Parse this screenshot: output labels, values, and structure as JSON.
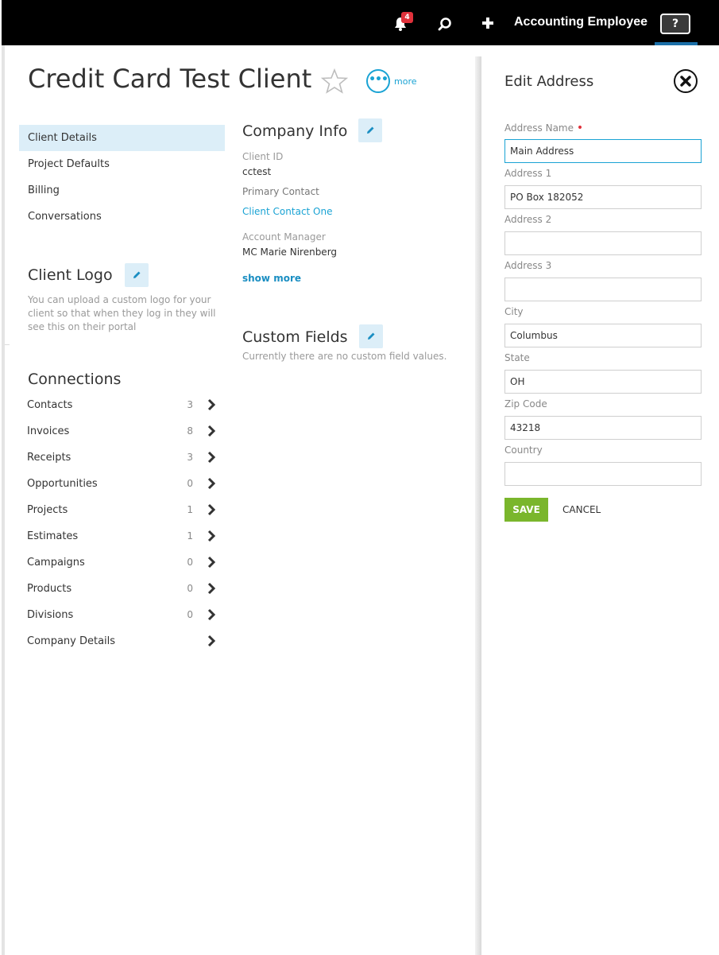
{
  "topbar": {
    "notification_count": "4",
    "user_name": "Accounting Employee",
    "help_label": "?",
    "icons": [
      "bell-icon",
      "search-icon",
      "plus-icon"
    ]
  },
  "header": {
    "title": "Credit Card Test Client",
    "more_label": "more"
  },
  "nav": {
    "items": [
      {
        "label": "Client Details",
        "active": true
      },
      {
        "label": "Project Defaults",
        "active": false
      },
      {
        "label": "Billing",
        "active": false
      },
      {
        "label": "Conversations",
        "active": false
      }
    ]
  },
  "client_logo": {
    "title": "Client Logo",
    "description": "You can upload a custom logo for your client so that when they log in they will see this on their portal"
  },
  "connections": {
    "title": "Connections",
    "rows": [
      {
        "label": "Contacts",
        "count": "3"
      },
      {
        "label": "Invoices",
        "count": "8"
      },
      {
        "label": "Receipts",
        "count": "3"
      },
      {
        "label": "Opportunities",
        "count": "0"
      },
      {
        "label": "Projects",
        "count": "1"
      },
      {
        "label": "Estimates",
        "count": "1"
      },
      {
        "label": "Campaigns",
        "count": "0"
      },
      {
        "label": "Products",
        "count": "0"
      },
      {
        "label": "Divisions",
        "count": "0"
      },
      {
        "label": "Company Details",
        "count": ""
      }
    ]
  },
  "company_info": {
    "title": "Company Info",
    "client_id_label": "Client ID",
    "client_id": "cctest",
    "primary_contact_label": "Primary Contact",
    "primary_contact": "Client Contact One",
    "account_manager_label": "Account Manager",
    "account_manager": "MC Marie Nirenberg",
    "show_more": "show more"
  },
  "custom_fields": {
    "title": "Custom Fields",
    "empty_text": "Currently there are no custom field values."
  },
  "edit_address": {
    "title": "Edit Address",
    "fields": [
      {
        "label": "Address Name",
        "value": "Main Address",
        "required": true
      },
      {
        "label": "Address 1",
        "value": "PO Box 182052"
      },
      {
        "label": "Address 2",
        "value": ""
      },
      {
        "label": "Address 3",
        "value": ""
      },
      {
        "label": "City",
        "value": "Columbus"
      },
      {
        "label": "State",
        "value": "OH"
      },
      {
        "label": "Zip Code",
        "value": "43218"
      },
      {
        "label": "Country",
        "value": ""
      }
    ],
    "save_label": "SAVE",
    "cancel_label": "CANCEL"
  },
  "colors": {
    "accent": "#1aa3d4",
    "save_green": "#7ab62c",
    "badge_red": "#e0313b",
    "nav_active_bg": "#dceef8"
  }
}
